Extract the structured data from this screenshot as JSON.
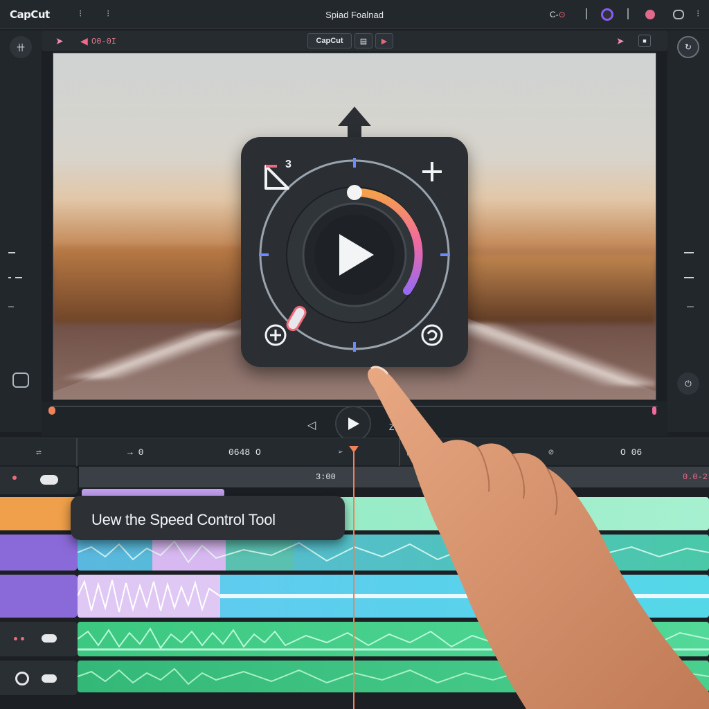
{
  "topbar": {
    "logo": "CapCut",
    "title": "Spiad Foalnad",
    "status_text": "C-",
    "colors": {
      "accent": "#f06a7a",
      "purple": "#8a5cf0"
    }
  },
  "toolbar": {
    "time_display": "O0-0I",
    "center_logo": "CapCut",
    "doc_icon": "document-icon",
    "play_icon": "play-icon"
  },
  "preview": {
    "speed_marker": "3"
  },
  "playback": {
    "zoom_label": "Z"
  },
  "timeline": {
    "header_times": [
      "→ 0",
      "0648 O",
      "O 06"
    ],
    "ruler_labels": [
      "3:00",
      "0.0-2"
    ],
    "tooltip": "Uew the Speed Control Tool"
  }
}
